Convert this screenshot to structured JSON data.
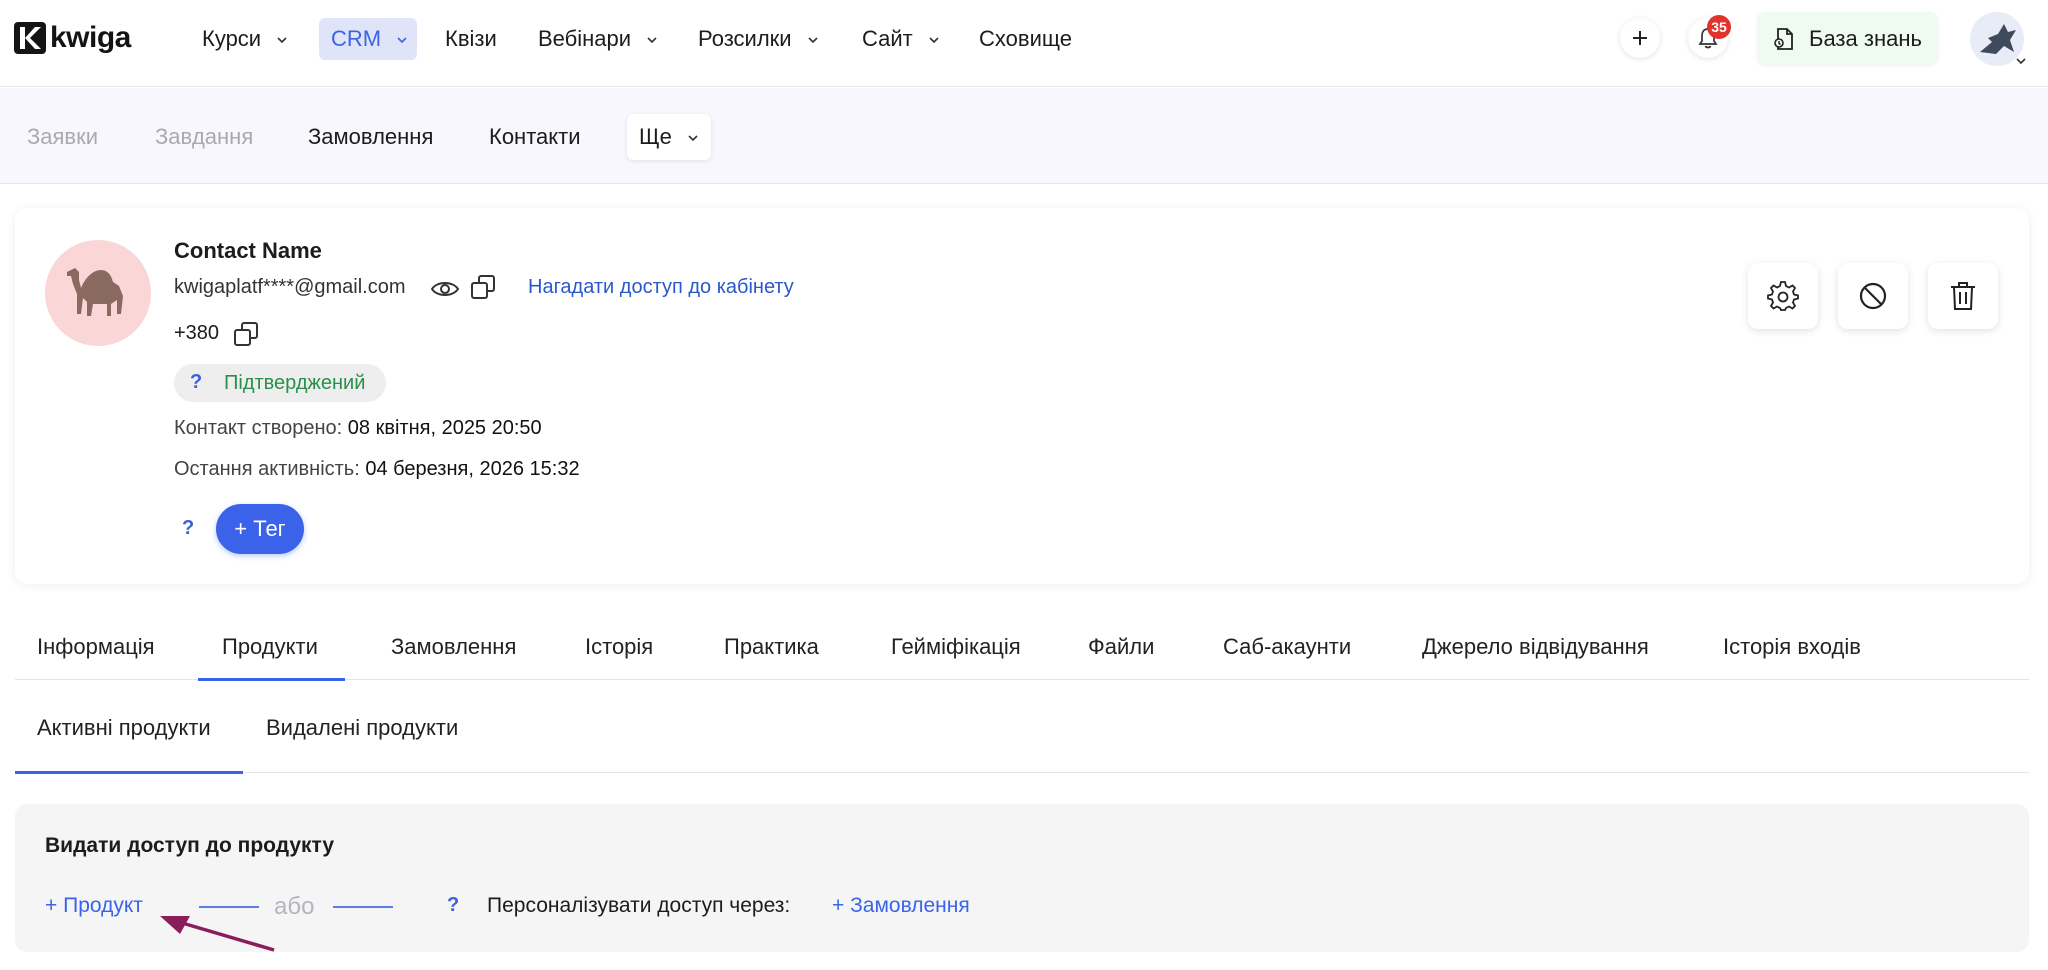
{
  "brand": {
    "name": "kwiga",
    "accent": "#3a63ea"
  },
  "topnav": {
    "items": [
      {
        "label": "Курси",
        "dropdown": true
      },
      {
        "label": "CRM",
        "dropdown": true,
        "active": true
      },
      {
        "label": "Квізи",
        "dropdown": false
      },
      {
        "label": "Вебінари",
        "dropdown": true
      },
      {
        "label": "Розсилки",
        "dropdown": true
      },
      {
        "label": "Сайт",
        "dropdown": true
      },
      {
        "label": "Сховище",
        "dropdown": false
      }
    ],
    "notifications_count": "35",
    "knowledge_base_label": "База знань"
  },
  "subnav": {
    "items": [
      {
        "label": "Заявки",
        "muted": true
      },
      {
        "label": "Завдання",
        "muted": true
      },
      {
        "label": "Замовлення",
        "muted": false
      },
      {
        "label": "Контакти",
        "muted": false
      }
    ],
    "more_label": "Ще"
  },
  "contact": {
    "name": "Contact Name",
    "email": "kwigaplatf****@gmail.com",
    "remind_link": "Нагадати доступ до кабінету",
    "phone": "+380",
    "status": "Підтверджений",
    "help_mark": "?",
    "created_label": "Контакт створено:",
    "created_value": "08 квітня, 2025 20:50",
    "activity_label": "Остання активність:",
    "activity_value": "04 березня, 2026 15:32",
    "tag_button": "+ Тег"
  },
  "tabs": [
    "Інформація",
    "Продукти",
    "Замовлення",
    "Історія",
    "Практика",
    "Гейміфікація",
    "Файли",
    "Саб-акаунти",
    "Джерело відвідування",
    "Історія входів"
  ],
  "subtabs": [
    "Активні продукти",
    "Видалені продукти"
  ],
  "access": {
    "title": "Видати доступ до продукту",
    "add_product": "+ Продукт",
    "or": "або",
    "personalize_label": "Персоналізувати доступ через:",
    "add_order": "+ Замовлення"
  }
}
